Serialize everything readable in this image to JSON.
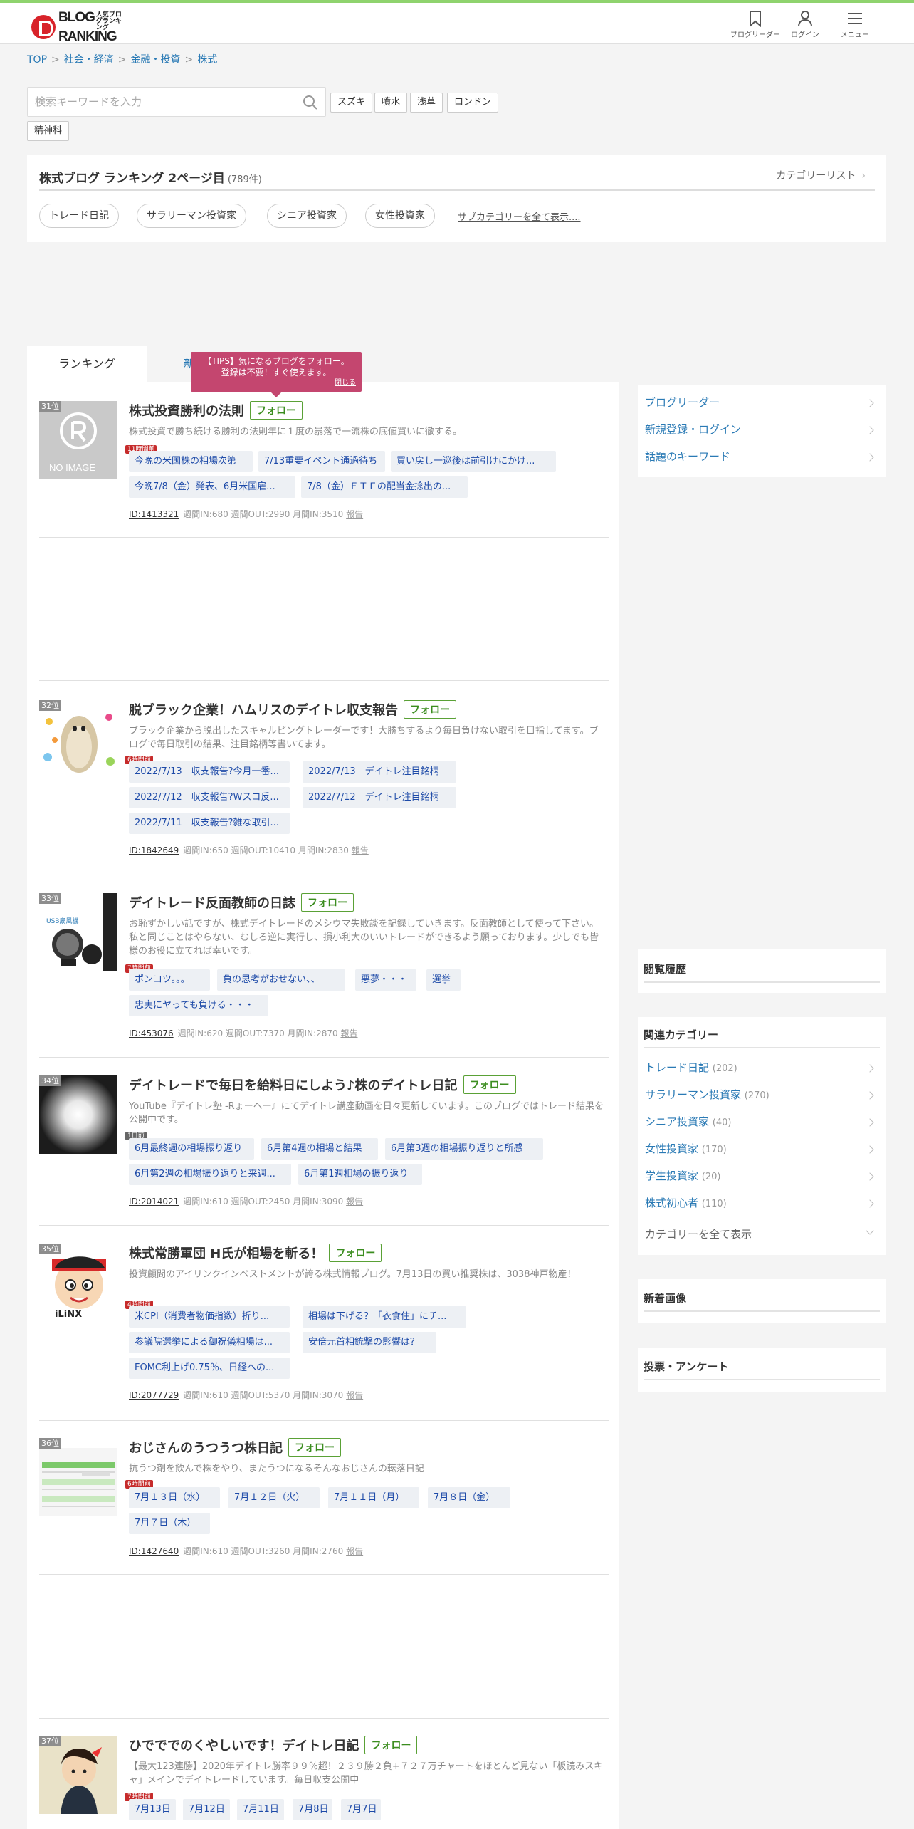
{
  "header": {
    "logo_text": "BLOG RANKING",
    "logo_sub": "人気ブログランキング",
    "nav": [
      {
        "label": "ブログリーダー",
        "icon": "bookmark-icon"
      },
      {
        "label": "ログイン",
        "icon": "user-icon"
      },
      {
        "label": "メニュー",
        "icon": "hamburger-icon"
      }
    ]
  },
  "breadcrumb": [
    "TOP",
    "社会・経済",
    "金融・投資",
    "株式"
  ],
  "search": {
    "placeholder": "検索キーワードを入力",
    "keywords": [
      "スズキ",
      "噴水",
      "浅草",
      "ロンドン",
      "精神科"
    ]
  },
  "ranking": {
    "title": "株式ブログ ランキング 2ページ目",
    "count": "(789件)",
    "category_list": "カテゴリーリスト",
    "subcategories": [
      "トレード日記",
      "サラリーマン投資家",
      "シニア投資家",
      "女性投資家"
    ],
    "show_all_sub": "サブカテゴリーを全て表示...."
  },
  "tabs": {
    "active": "ランキング",
    "inactive": "新"
  },
  "tips": {
    "line1": "【TIPS】気になるブログをフォロー。",
    "line2": "登録は不要！すぐ使えます。",
    "close": "閉じる"
  },
  "follow_label": "フォロー",
  "report_label": "報告",
  "entries": [
    {
      "rank": "31位",
      "title": "株式投資勝利の法則",
      "desc": "株式投資で勝ち続ける勝利の法則年に１度の暴落で一流株の底値買いに徹する。",
      "time": "11時間前",
      "articles": [
        "今晩の米国株の相場次第",
        "7/13重要イベント通過待ち",
        "買い戻し一巡後は前引けにかけ...",
        "今晩7/8（金）発表、6月米国雇...",
        "7/8（金）ＥＴＦの配当金捻出の..."
      ],
      "id": "ID:1413321",
      "stats": "週間IN:680 週間OUT:2990 月間IN:3510"
    },
    {
      "rank": "32位",
      "title": "脱ブラック企業！ハムリスのデイトレ収支報告",
      "desc": "ブラック企業から脱出したスキャルピングトレーダーです！大勝ちするより毎日負けない取引を目指してます。ブログで毎日取引の結果、注目銘柄等書いてます。",
      "time": "6時間前",
      "articles": [
        "2022/7/13　収支報告?今月一番...",
        "2022/7/13　デイトレ注目銘柄",
        "2022/7/12　収支報告?Wスコ反...",
        "2022/7/12　デイトレ注目銘柄",
        "2022/7/11　収支報告?雑な取引..."
      ],
      "id": "ID:1842649",
      "stats": "週間IN:650 週間OUT:10410 月間IN:2830"
    },
    {
      "rank": "33位",
      "title": "デイトレード反面教師の日誌",
      "desc": "お恥ずかしい話ですが、株式デイトレードのメシウマ失敗談を記録していきます。反面教師として使って下さい。私と同じことはやらない、むしろ逆に実行し、損小利大のいいトレードができるよう願っております。少しでも皆様のお役に立てれば幸いです。",
      "time": "7時間前",
      "articles": [
        "ポンコツ。。。",
        "負の思考がおせない、、",
        "悪夢・・・",
        "選挙",
        "忠実にヤっても負ける・・・"
      ],
      "id": "ID:453076",
      "stats": "週間IN:620 週間OUT:7370 月間IN:2870"
    },
    {
      "rank": "34位",
      "title": "デイトレードで毎日を給料日にしよう♪株のデイトレ日記",
      "desc": "YouTube『デイトレ塾 -Rょーへー』にてデイトレ講座動画を日々更新しています。このブログではトレード結果を公開中です。",
      "time": "1日前",
      "articles": [
        "6月最終週の相場振り返り",
        "6月第4週の相場と結果",
        "6月第3週の相場振り返りと所感",
        "6月第2週の相場振り返りと来週...",
        "6月第1週相場の振り返り"
      ],
      "id": "ID:2014021",
      "stats": "週間IN:610 週間OUT:2450 月間IN:3090"
    },
    {
      "rank": "35位",
      "title": "株式常勝軍団 H氏が相場を斬る！",
      "desc": "投資顧問のアイリンクインベストメントが誇る株式情報ブログ。7月13日の買い推奨株は、3038神戸物産！",
      "time": "4時間前",
      "articles": [
        "米CPI（消費者物価指数）折り...",
        "相場は下げる？「衣食住」にチ...",
        "参議院選挙による御祝儀相場は...",
        "安倍元首相銃撃の影響は？",
        "FOMC利上げ0.75％、日経への..."
      ],
      "id": "ID:2077729",
      "stats": "週間IN:610 週間OUT:5370 月間IN:3070"
    },
    {
      "rank": "36位",
      "title": "おじさんのうつうつ株日記",
      "desc": "抗うつ剤を飲んで株をやり、またうつになるそんなおじさんの転落日記",
      "time": "6時間前",
      "articles": [
        "7月１３日（水）",
        "7月１２日（火）",
        "7月１１日（月）",
        "7月８日（金）",
        "7月７日（木）"
      ],
      "id": "ID:1427640",
      "stats": "週間IN:610 週間OUT:3260 月間IN:2760"
    },
    {
      "rank": "37位",
      "title": "ひでででのくやしいです！デイトレ日記",
      "desc": "【最大123連勝】2020年デイトレ勝率９９％超！２３９勝２負+７２７万チャートをほとんど見ない「板読みスキャ」メインでデイトレードしています。毎日収支公開中",
      "time": "7時間前",
      "articles": [
        "7月13日",
        "7月12日",
        "7月11日",
        "7月8日",
        "7月7日"
      ],
      "id": "",
      "stats": ""
    }
  ],
  "thumb_no_image": "NO IMAGE",
  "thumb_usb": "USB扇風機",
  "thumb_linx": "iLiNX",
  "side_links": [
    "ブログリーダー",
    "新規登録・ログイン",
    "話題のキーワード"
  ],
  "history_title": "閲覧履歴",
  "related": {
    "title": "関連カテゴリー",
    "items": [
      {
        "label": "トレード日記",
        "count": "(202)"
      },
      {
        "label": "サラリーマン投資家",
        "count": "(270)"
      },
      {
        "label": "シニア投資家",
        "count": "(40)"
      },
      {
        "label": "女性投資家",
        "count": "(170)"
      },
      {
        "label": "学生投資家",
        "count": "(20)"
      },
      {
        "label": "株式初心者",
        "count": "(110)"
      }
    ],
    "show_all": "カテゴリーを全て表示"
  },
  "new_images_title": "新着画像",
  "vote_title": "投票・アンケート",
  "colors": {
    "accent_green": "#8fd36e",
    "link_blue": "#2a7ab5",
    "tips_pink": "#c4466f",
    "follow_green": "#3b8d1f"
  }
}
